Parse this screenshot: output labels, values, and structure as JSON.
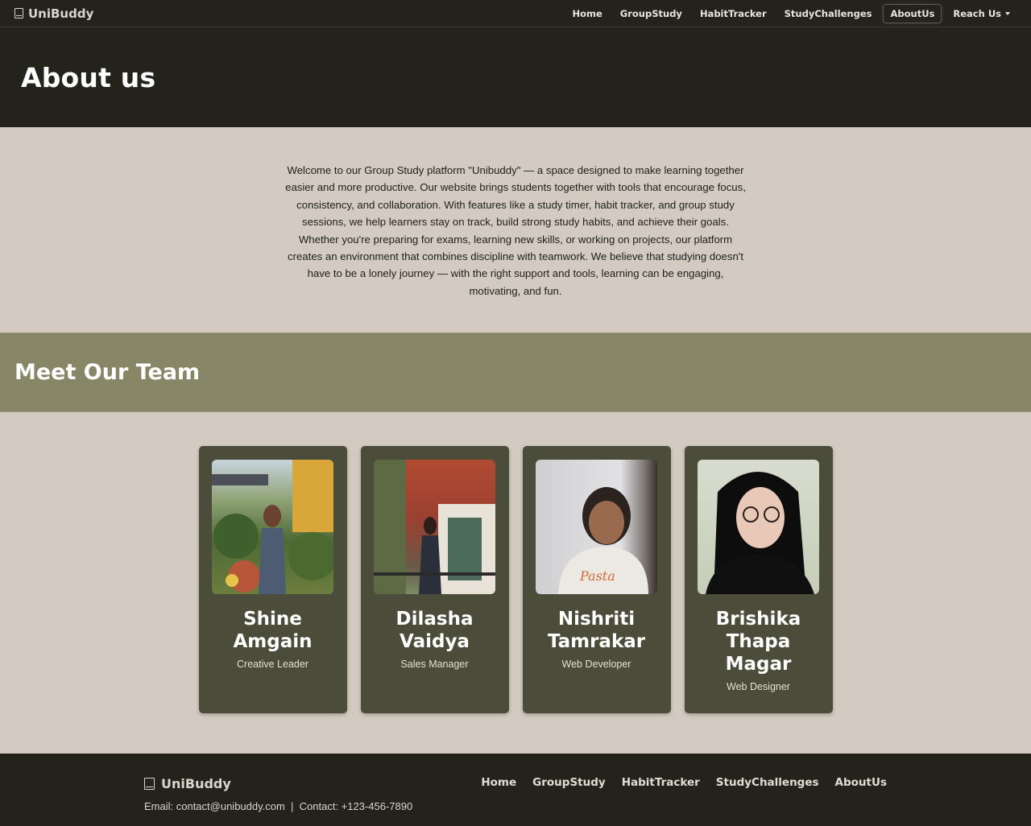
{
  "navbar": {
    "brand": "UniBuddy",
    "links": [
      {
        "label": "Home"
      },
      {
        "label": "GroupStudy"
      },
      {
        "label": "HabitTracker"
      },
      {
        "label": "StudyChallenges"
      },
      {
        "label": "AboutUs"
      },
      {
        "label": "Reach Us"
      }
    ]
  },
  "header": {
    "title": "About us"
  },
  "about": {
    "text": "Welcome to our Group Study platform \"Unibuddy\" — a space designed to make learning together easier and more productive. Our website brings students together with tools that encourage focus, consistency, and collaboration. With features like a study timer, habit tracker, and group study sessions, we help learners stay on track, build strong study habits, and achieve their goals. Whether you're preparing for exams, learning new skills, or working on projects, our platform creates an environment that combines discipline with teamwork. We believe that studying doesn't have to be a lonely journey — with the right support and tools, learning can be engaging, motivating, and fun."
  },
  "team": {
    "title": "Meet Our Team",
    "members": [
      {
        "name": "Shine Amgain",
        "role": "Creative Leader"
      },
      {
        "name": "Dilasha Vaidya",
        "role": "Sales Manager"
      },
      {
        "name": "Nishriti Tamrakar",
        "role": "Web Developer"
      },
      {
        "name": "Brishika Thapa Magar",
        "role": "Web Designer"
      }
    ]
  },
  "footer": {
    "brand": "UniBuddy",
    "contact": "Email: contact@unibuddy.com  |  Contact: +123-456-7890",
    "links": [
      {
        "label": "Home"
      },
      {
        "label": "GroupStudy"
      },
      {
        "label": "HabitTracker"
      },
      {
        "label": "StudyChallenges"
      },
      {
        "label": "AboutUs"
      }
    ]
  },
  "colors": {
    "dark": "#23221b",
    "olive": "#878768",
    "card": "#4b4c39",
    "beige": "#d3cbc1"
  }
}
